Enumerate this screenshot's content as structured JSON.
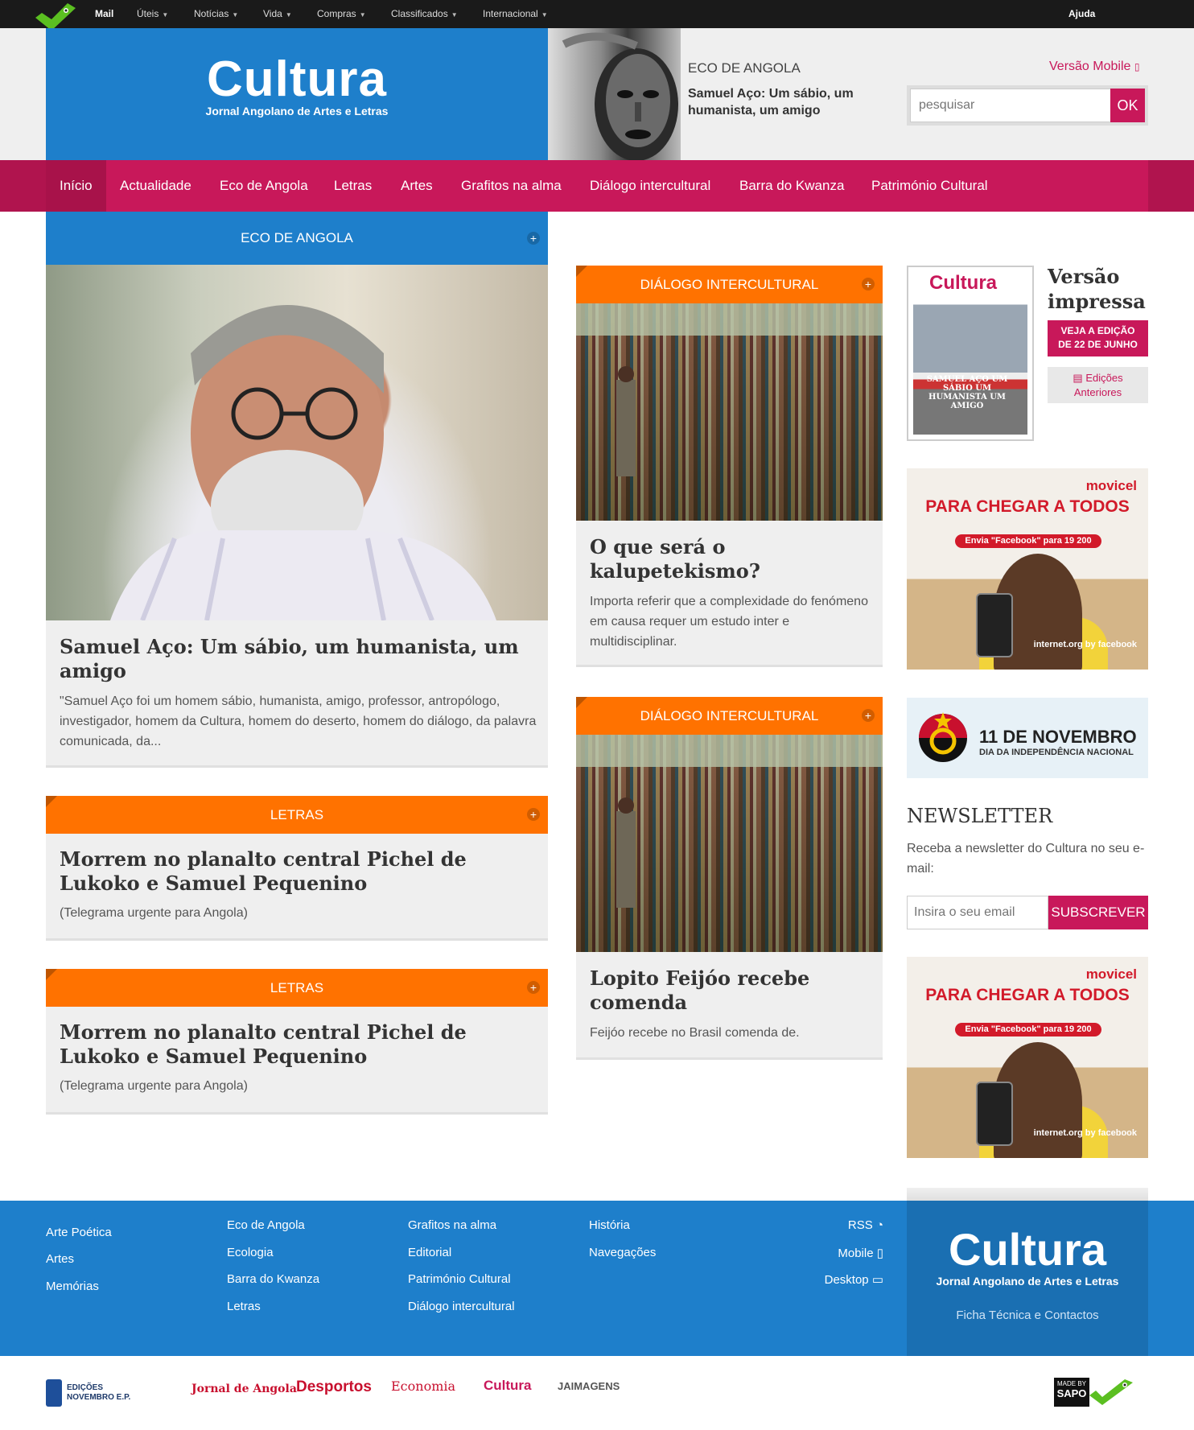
{
  "topbar": {
    "mail": "Mail",
    "items": [
      "Úteis",
      "Notícias",
      "Vida",
      "Compras",
      "Classificados",
      "Internacional"
    ],
    "help": "Ajuda"
  },
  "header": {
    "brand_name": "Cultura",
    "brand_tagline": "Jornal Angolano de Artes e Letras",
    "featured_section": "ECO DE ANGOLA",
    "featured_title": "Samuel Aço: Um sábio, um humanista, um amigo",
    "mobile_link": "Versão Mobile",
    "search_placeholder": "pesquisar",
    "search_button": "OK"
  },
  "nav": [
    "Início",
    "Actualidade",
    "Eco de Angola",
    "Letras",
    "Artes",
    "Grafitos na alma",
    "Diálogo intercultural",
    "Barra do Kwanza",
    "Património Cultural"
  ],
  "left_column": {
    "main": {
      "section": "ECO DE ANGOLA",
      "title": "Samuel Aço: Um sábio, um humanista, um amigo",
      "excerpt": "\"Samuel Aço foi um homem sábio, humanista, amigo, professor, antropólogo, investigador, homem da Cultura, homem do deserto, homem do diálogo, da palavra comunicada, da..."
    },
    "letras1": {
      "section": "LETRAS",
      "title": "Morrem no planalto central Pichel de Lukoko e Samuel Pequenino",
      "excerpt": "(Telegrama urgente para Angola)"
    },
    "letras2": {
      "section": "LETRAS",
      "title": "Morrem no planalto central Pichel de Lukoko e Samuel Pequenino",
      "excerpt": "(Telegrama urgente para Angola)"
    }
  },
  "middle_column": {
    "card1": {
      "section": "DIÁLOGO INTERCULTURAL",
      "title": "O que será o kalupetekismo?",
      "excerpt": "Importa referir que a complexidade do fenómeno em causa requer um estudo inter e multidisciplinar."
    },
    "card2": {
      "section": "DIÁLOGO INTERCULTURAL",
      "title": "Lopito Feijóo recebe comenda",
      "excerpt": "Feijóo recebe no Brasil comenda de."
    }
  },
  "right_column": {
    "print_title": "Versão impressa",
    "edition_button": "VEJA A EDIÇÃO DE 22 DE JUNHO",
    "previous_editions": "Edições Anteriores",
    "magazine_title": "Cultura",
    "magazine_headline": "SAMUEL AÇO UM SÁBIO UM HUMANISTA UM AMIGO",
    "ad": {
      "brand": "movicel",
      "headline": "PARA CHEGAR A TODOS",
      "pill": "Envia \"Facebook\" para 19 200",
      "partner": "internet.org by facebook"
    },
    "banner": {
      "title": "11 DE NOVEMBRO",
      "subtitle": "DIA DA INDEPENDÊNCIA NACIONAL"
    },
    "newsletter": {
      "title": "NEWSLETTER",
      "text": "Receba a newsletter do Cultura no seu e-mail:",
      "placeholder": "Insira o seu email",
      "button": "SUBSCREVER"
    }
  },
  "footer": {
    "col1": [
      "Arte Poética",
      "Artes",
      "Memórias"
    ],
    "col2": [
      "Eco de Angola",
      "Ecologia",
      "Barra do Kwanza",
      "Letras"
    ],
    "col3": [
      "Grafitos na alma",
      "Editorial",
      "Património Cultural",
      "Diálogo intercultural"
    ],
    "col4": [
      "História",
      "Navegações"
    ],
    "col5": [
      "RSS",
      "Mobile",
      "Desktop"
    ],
    "brand_name": "Cultura",
    "brand_tagline": "Jornal Angolano de Artes e Letras",
    "contacts": "Ficha Técnica e Contactos"
  },
  "bottom_logos": {
    "edicoes": "EDIÇÕES NOVEMBRO E.P.",
    "jornal": "Jornal de Angola",
    "desportos": "Desportos",
    "economia": "Economia",
    "cultura": "Cultura",
    "jaimagens": "JAIMAGENS",
    "made_by": "MADE BY",
    "sapo": "SAPO"
  }
}
